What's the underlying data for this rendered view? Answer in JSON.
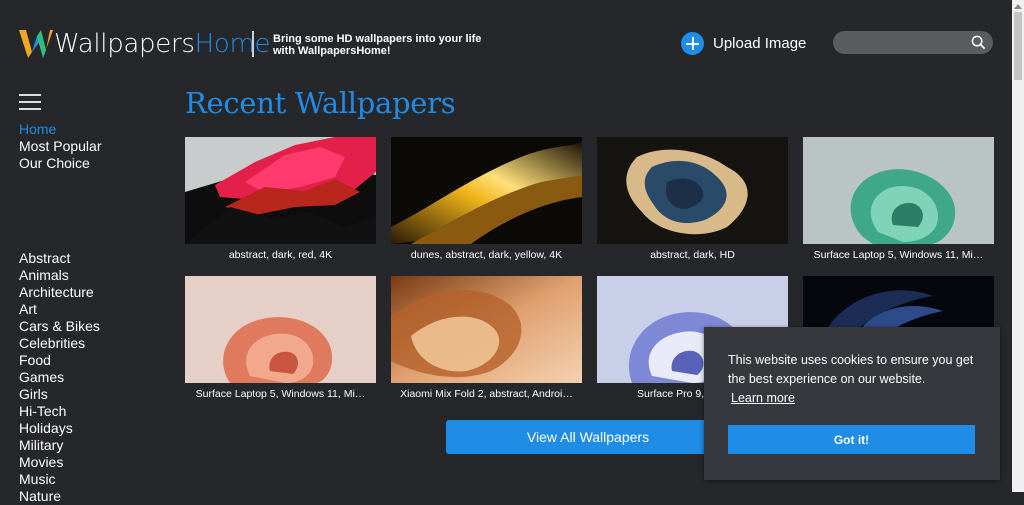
{
  "header": {
    "logo_part1": "Wallpapers",
    "logo_part2": "Home",
    "tagline": "Bring some HD wallpapers into your life with WallpapersHome!",
    "upload_label": "Upload Image",
    "search_value": "",
    "brand_color": "#1f8ce6"
  },
  "sidebar": {
    "menu_icon": "hamburger-icon",
    "nav": [
      {
        "label": "Home",
        "active": true
      },
      {
        "label": "Most Popular"
      },
      {
        "label": "Our Choice"
      }
    ],
    "categories": [
      "Abstract",
      "Animals",
      "Architecture",
      "Art",
      "Cars & Bikes",
      "Celebrities",
      "Food",
      "Games",
      "Girls",
      "Hi-Tech",
      "Holidays",
      "Military",
      "Movies",
      "Music",
      "Nature"
    ]
  },
  "main": {
    "title": "Recent Wallpapers",
    "cards": [
      {
        "caption": "abstract, dark, red, 4K"
      },
      {
        "caption": "dunes, abstract, dark, yellow, 4K"
      },
      {
        "caption": "abstract, dark, HD"
      },
      {
        "caption": "Surface Laptop 5, Windows 11, Mi…"
      },
      {
        "caption": "Surface Laptop 5, Windows 11, Mi…"
      },
      {
        "caption": "Xiaomi Mix Fold 2, abstract, Androi…"
      },
      {
        "caption": "Surface Pro 9, Surfac…"
      },
      {
        "caption": ""
      }
    ],
    "view_all_label": "View All Wallpapers"
  },
  "cookie": {
    "message": "This website uses cookies to ensure you get the best experience on our website.",
    "learn_more": "Learn more",
    "accept": "Got it!"
  }
}
